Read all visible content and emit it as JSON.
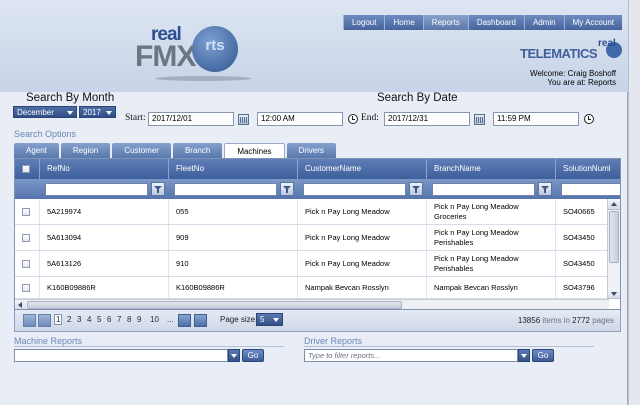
{
  "nav": [
    "Logout",
    "Home",
    "Reports",
    "Dashboard",
    "Admin",
    "My Account"
  ],
  "nav_active": "Reports",
  "logo": {
    "real": "real",
    "fmx": "FMX",
    "rts": "rts",
    "tel_real": "real",
    "telematics": "TELEMATICS"
  },
  "welcome": {
    "line1": "Welcome: Craig Boshoff",
    "line2": "You are at: Reports"
  },
  "search_month": {
    "title": "Search By Month",
    "month": "December",
    "year": "2017"
  },
  "search_date": {
    "title": "Search By Date",
    "start_label": "Start:",
    "start_date": "2017/12/01",
    "start_time": "12:00 AM",
    "end_label": "End:",
    "end_date": "2017/12/31",
    "end_time": "11:59 PM"
  },
  "search_options": "Search Options",
  "tabs": [
    "Agent",
    "Region",
    "Customer",
    "Branch",
    "Machines",
    "Drivers"
  ],
  "active_tab": "Machines",
  "grid": {
    "columns": [
      "RefNo",
      "FleetNo",
      "CustomerName",
      "BranchName",
      "SolutionNuml"
    ],
    "rows": [
      [
        "5A219974",
        "055",
        "Pick n Pay Long Meadow",
        "Pick n Pay Long Meadow\nGroceries",
        "SO40665"
      ],
      [
        "5A613094",
        "909",
        "Pick n Pay Long Meadow",
        "Pick n Pay Long Meadow\nPerishables",
        "SO43450"
      ],
      [
        "5A613126",
        "910",
        "Pick n Pay Long Meadow",
        "Pick n Pay Long Meadow\nPerishables",
        "SO43450"
      ],
      [
        "K160B09886R",
        "K160B09886R",
        "Nampak Bevcan Rosslyn",
        "Nampak Bevcan Rosslyn",
        "SO43796"
      ]
    ]
  },
  "pager": {
    "pages": [
      "1",
      "2",
      "3",
      "4",
      "5",
      "6",
      "7",
      "8",
      "9",
      "10",
      "..."
    ],
    "current": "1",
    "page_size_label": "Page size:",
    "page_size": "5",
    "items_total": "13856",
    "items_text": "items in",
    "pages_total": "2772",
    "pages_text": "pages"
  },
  "machine_reports": {
    "title": "Machine Reports",
    "placeholder": "",
    "go": "Go"
  },
  "driver_reports": {
    "title": "Driver Reports",
    "placeholder": "Type to filter reports...",
    "go": "Go"
  },
  "colors": {
    "nav_bg": "#46639c",
    "accent": "#6b86b6",
    "header_bg": "#dde5f2"
  }
}
